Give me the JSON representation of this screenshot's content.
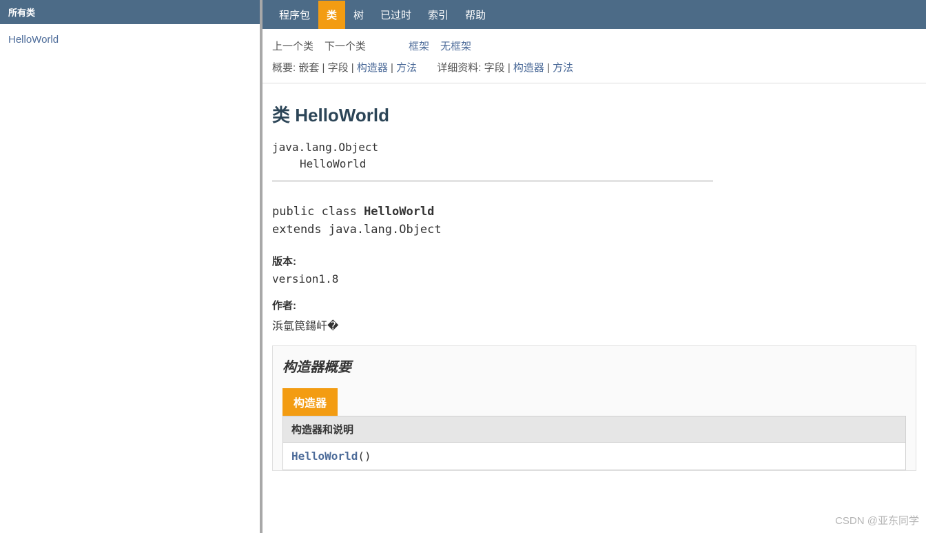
{
  "left": {
    "title": "所有类",
    "class_link": "HelloWorld"
  },
  "topnav": {
    "items": [
      {
        "label": "程序包",
        "active": false
      },
      {
        "label": "类",
        "active": true
      },
      {
        "label": "树",
        "active": false
      },
      {
        "label": "已过时",
        "active": false
      },
      {
        "label": "索引",
        "active": false
      },
      {
        "label": "帮助",
        "active": false
      }
    ]
  },
  "subnav": {
    "prev": "上一个类",
    "next": "下一个类",
    "frames": "框架",
    "noframes": "无框架"
  },
  "summary_line": {
    "overview_label": "概要: ",
    "nested": "嵌套",
    "sep": " | ",
    "field": "字段",
    "ctor": "构造器",
    "method": "方法",
    "detail_label": "详细资料: ",
    "d_field": "字段",
    "d_ctor": "构造器",
    "d_method": "方法"
  },
  "class": {
    "title_prefix": "类 ",
    "title_name": "HelloWorld",
    "inheritance_parent": "java.lang.Object",
    "inheritance_self": "HelloWorld",
    "decl_line1_pre": "public class ",
    "decl_line1_name": "HelloWorld",
    "decl_line2": "extends java.lang.Object",
    "version_label": "版本:",
    "version_value": "version1.8",
    "author_label": "作者:",
    "author_value": "浜氫笢鍚屽�"
  },
  "ctor_summary": {
    "heading": "构造器概要",
    "tab": "构造器",
    "col_header": "构造器和说明",
    "entry_name": "HelloWorld",
    "entry_suffix": "()"
  },
  "watermark": "CSDN @亚东同学"
}
